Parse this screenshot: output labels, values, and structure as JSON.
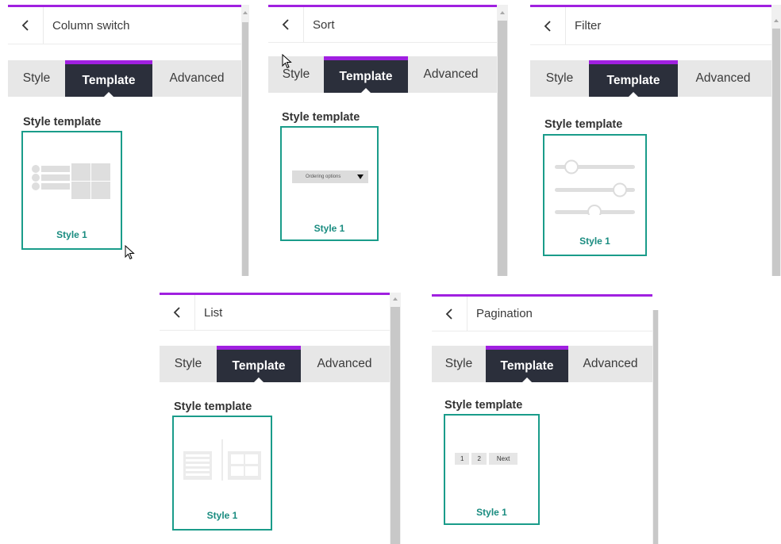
{
  "tabs": {
    "style": "Style",
    "template": "Template",
    "advanced": "Advanced"
  },
  "section_title": "Style template",
  "card_label": "Style 1",
  "panels": {
    "column_switch": {
      "title": "Column switch"
    },
    "sort": {
      "title": "Sort",
      "preview_text": "Ordering options"
    },
    "filter": {
      "title": "Filter"
    },
    "list": {
      "title": "List"
    },
    "pagination": {
      "title": "Pagination",
      "pages": [
        "1",
        "2",
        "Next"
      ]
    }
  },
  "colors": {
    "accent": "#a020e0",
    "active_tab_bg": "#2b2f3b",
    "card_border": "#1a9c8a"
  },
  "icons": [
    "chevron-left-icon",
    "cursor-icon"
  ]
}
